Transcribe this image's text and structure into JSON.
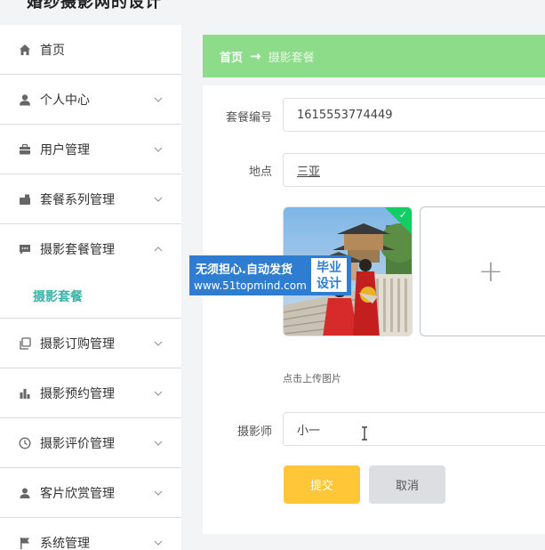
{
  "app": {
    "title": "婚纱摄影网的设计"
  },
  "sidebar": {
    "items": [
      {
        "label": "首页",
        "icon": "home-icon",
        "expanded": null
      },
      {
        "label": "个人中心",
        "icon": "user-icon",
        "expanded": false
      },
      {
        "label": "用户管理",
        "icon": "briefcase-icon",
        "expanded": false
      },
      {
        "label": "套餐系列管理",
        "icon": "folder-icon",
        "expanded": false
      },
      {
        "label": "摄影套餐管理",
        "icon": "chat-icon",
        "expanded": true
      },
      {
        "label": "摄影订购管理",
        "icon": "copy-icon",
        "expanded": false
      },
      {
        "label": "摄影预约管理",
        "icon": "bar-chart-icon",
        "expanded": false
      },
      {
        "label": "摄影评价管理",
        "icon": "clock-icon",
        "expanded": false
      },
      {
        "label": "客片欣赏管理",
        "icon": "person-icon",
        "expanded": false
      },
      {
        "label": "系统管理",
        "icon": "flag-icon",
        "expanded": false
      }
    ],
    "active_sub_item": "摄影套餐"
  },
  "breadcrumb": {
    "home": "首页",
    "separator": "→",
    "current": "摄影套餐"
  },
  "form": {
    "package_number": {
      "label": "套餐编号",
      "value": "1615553774449"
    },
    "location": {
      "label": "地点",
      "value": "三亚"
    },
    "upload": {
      "hint": "点击上传图片",
      "add_symbol": "+",
      "uploaded": true
    },
    "photographer": {
      "label": "摄影师",
      "value": "小一"
    },
    "submit_label": "提交",
    "cancel_label": "取消"
  },
  "watermark": {
    "line1": "无须担心.自动发货",
    "line2": "www.51topmind.com",
    "badge_line1": "毕业",
    "badge_line2": "设计"
  },
  "colors": {
    "breadcrumb_bg": "#8cdc8a",
    "active_sub": "#3bb4a8",
    "submit": "#ffc637",
    "cancel": "#dcdee2",
    "success_badge": "#13ce66",
    "watermark": "#2f7dd0"
  }
}
